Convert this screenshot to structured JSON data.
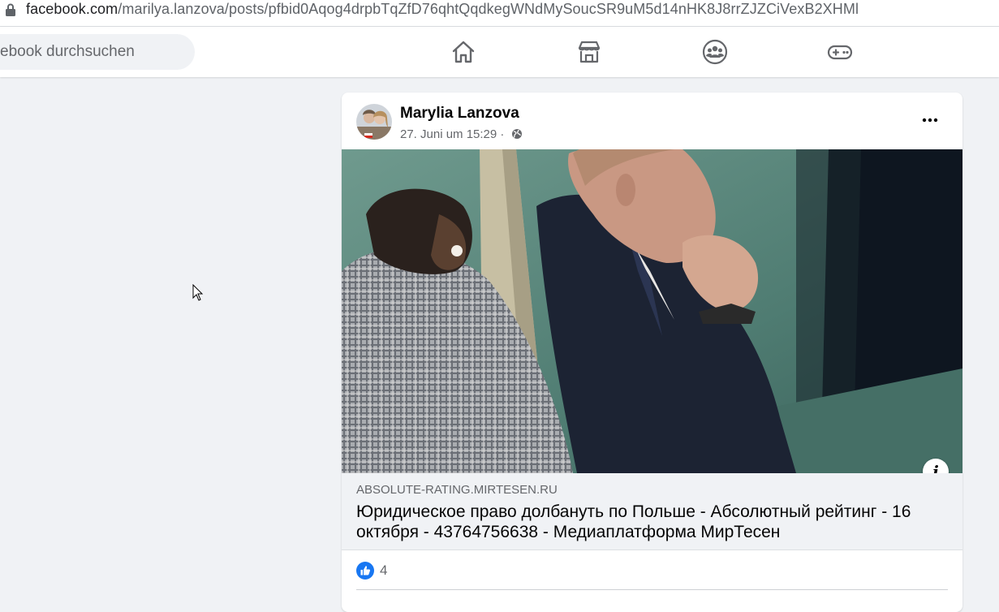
{
  "browser": {
    "url_domain": "facebook.com",
    "url_path": "/marilya.lanzova/posts/pfbid0Aqog4drpbTqZfD76qhtQqdkegWNdMySoucSR9uM5d14nHK8J8rrZJZCiVexB2XHMl"
  },
  "header": {
    "search_placeholder": "ebook durchsuchen",
    "nav": [
      {
        "icon": "home-icon"
      },
      {
        "icon": "marketplace-icon"
      },
      {
        "icon": "groups-icon"
      },
      {
        "icon": "gaming-icon"
      }
    ]
  },
  "post": {
    "author": "Marylia Lanzova",
    "timestamp": "27. Juni um 15:29 ·",
    "link": {
      "domain": "ABSOLUTE-RATING.MIRTESEN.RU",
      "title": "Юридическое право долбануть по Польше - Абсолютный рейтинг - 16 октября - 43764756638 - Медиаплатформа МирТесен"
    },
    "reactions": {
      "count": "4"
    }
  },
  "colors": {
    "brand_blue": "#1877f2",
    "background": "#f0f2f5",
    "secondary_text": "#65676b"
  }
}
